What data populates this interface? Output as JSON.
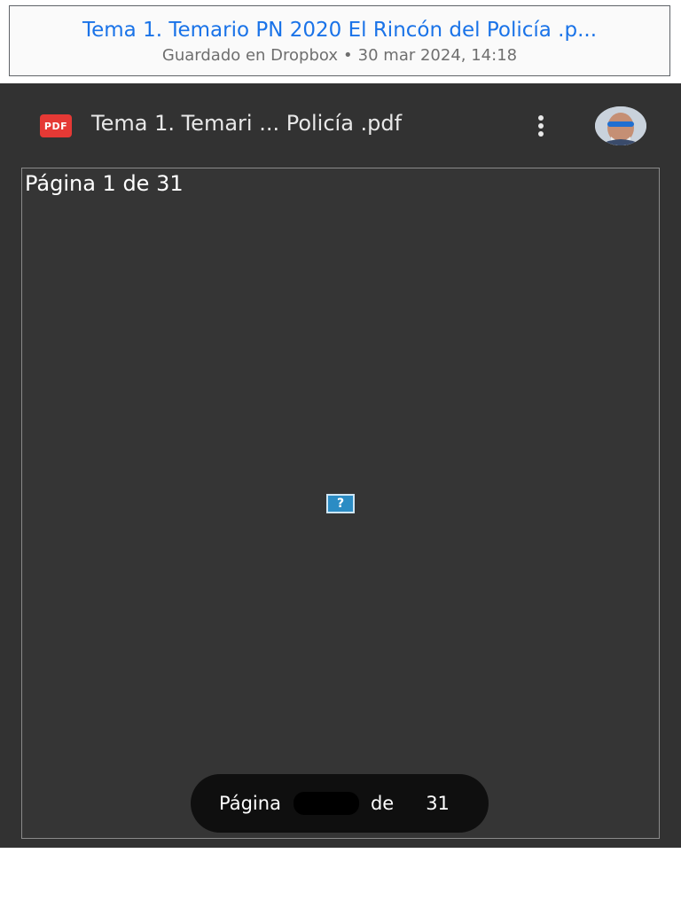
{
  "embed": {
    "title": "Tema 1. Temario PN 2020 El Rincón del Policía .p...",
    "saved_location": "Guardado en Dropbox",
    "separator": "•",
    "saved_date": "30 mar 2024, 14:18"
  },
  "viewer": {
    "file_badge": "PDF",
    "file_title": "Tema 1. Temari ... Policía .pdf",
    "page_label": "Página 1 de 31",
    "missing_image_glyph": "?",
    "page_nav": {
      "label": "Página",
      "current": "",
      "of": "de",
      "total": "31"
    }
  },
  "colors": {
    "link_blue": "#1a73e8",
    "viewer_bg": "#323232",
    "pdf_red": "#e53935",
    "pill_bg": "#0f0f0f"
  },
  "icons": [
    "pdf-file-icon",
    "more-vert-icon",
    "avatar",
    "broken-image-icon"
  ]
}
